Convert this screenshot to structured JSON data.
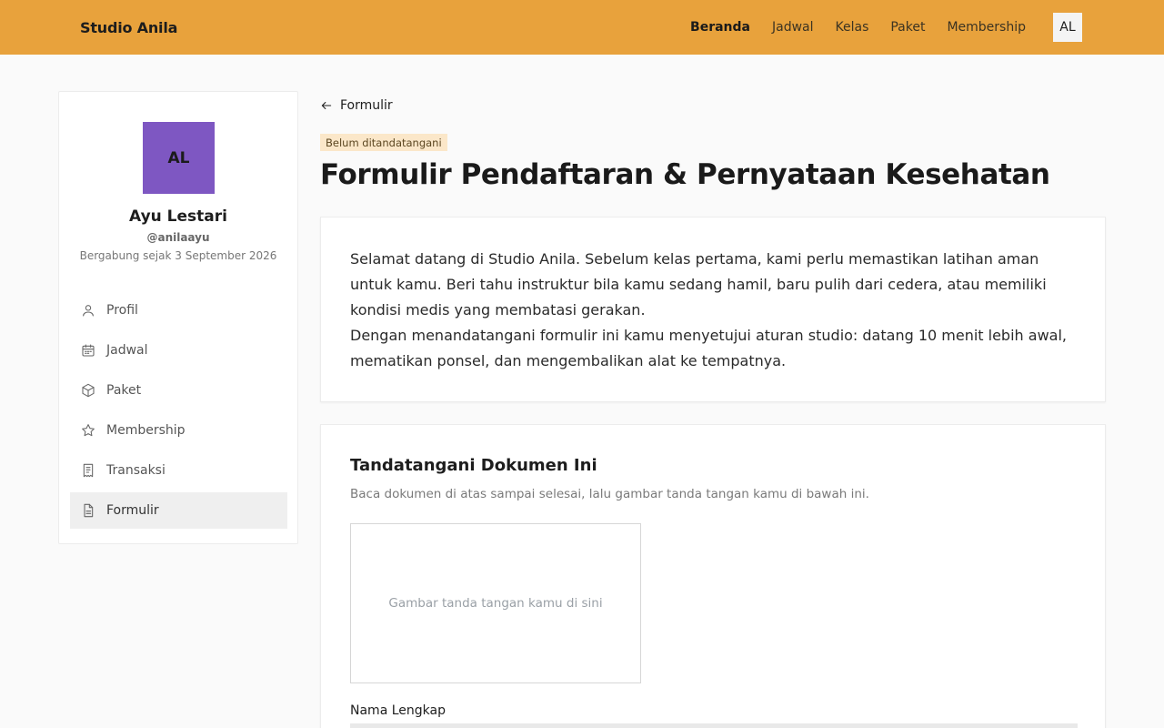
{
  "brand": "Studio Anila",
  "nav": {
    "items": [
      {
        "label": "Beranda",
        "active": true
      },
      {
        "label": "Jadwal",
        "active": false
      },
      {
        "label": "Kelas",
        "active": false
      },
      {
        "label": "Paket",
        "active": false
      },
      {
        "label": "Membership",
        "active": false
      }
    ],
    "avatar_initials": "AL"
  },
  "profile": {
    "initials": "AL",
    "avatar_color": "#7e57c2",
    "name": "Ayu Lestari",
    "handle": "@anilaayu",
    "joined": "Bergabung sejak 3 September 2026"
  },
  "sidebar": {
    "items": [
      {
        "label": "Profil",
        "icon": "user-icon",
        "active": false
      },
      {
        "label": "Jadwal",
        "icon": "calendar-icon",
        "active": false
      },
      {
        "label": "Paket",
        "icon": "package-icon",
        "active": false
      },
      {
        "label": "Membership",
        "icon": "star-icon",
        "active": false
      },
      {
        "label": "Transaksi",
        "icon": "receipt-icon",
        "active": false
      },
      {
        "label": "Formulir",
        "icon": "document-icon",
        "active": true
      }
    ]
  },
  "main": {
    "back_label": "Formulir",
    "status_badge": "Belum ditandatangani",
    "title": "Formulir Pendaftaran & Pernyataan Kesehatan",
    "intro_paragraphs": [
      "Selamat datang di Studio Anila. Sebelum kelas pertama, kami perlu memastikan latihan aman untuk kamu. Beri tahu instruktur bila kamu sedang hamil, baru pulih dari cedera, atau memiliki kondisi medis yang membatasi gerakan.",
      "Dengan menandatangani formulir ini kamu menyetujui aturan studio: datang 10 menit lebih awal, mematikan ponsel, dan mengembalikan alat ke tempatnya."
    ],
    "sign": {
      "title": "Tandatangani Dokumen Ini",
      "subtitle": "Baca dokumen di atas sampai selesai, lalu gambar tanda tangan kamu di bawah ini.",
      "pad_placeholder": "Gambar tanda tangan kamu di sini",
      "name_label": "Nama Lengkap",
      "name_value": ""
    }
  },
  "colors": {
    "topbar": "#e8a23c",
    "badge_bg": "#fbe7c9",
    "avatar": "#7e57c2"
  }
}
